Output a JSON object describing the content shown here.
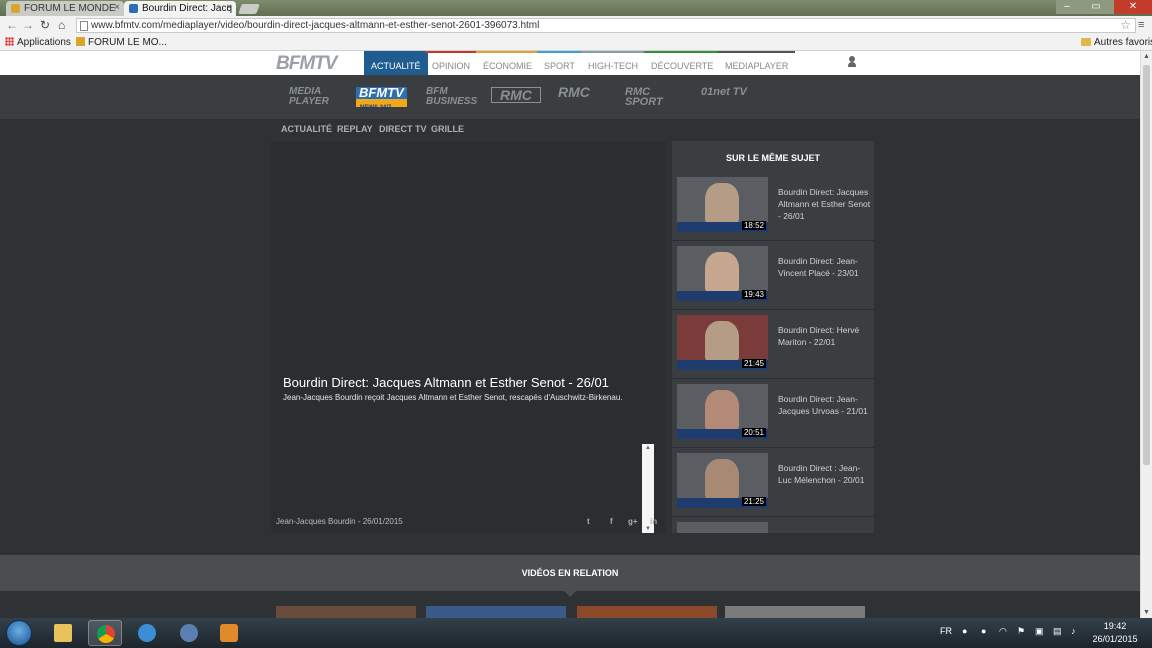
{
  "browser": {
    "tabs": [
      {
        "label": "FORUM LE MONDE",
        "active": false
      },
      {
        "label": "Bourdin Direct: Jacq",
        "active": true
      }
    ],
    "url": "www.bfmtv.com/mediaplayer/video/bourdin-direct-jacques-altmann-et-esther-senot-2601-396073.html",
    "bookmarks": {
      "apps": "Applications",
      "forum": "FORUM LE MO...",
      "other": "Autres favoris"
    }
  },
  "site": {
    "logo": "BFMTV",
    "nav": [
      "ACTUALITÉ",
      "OPINION",
      "ÉCONOMIE",
      "SPORT",
      "HIGH-TECH",
      "DÉCOUVERTE",
      "MEDIAPLAYER"
    ],
    "nav_colors": [
      "#1f5c8f",
      "#c0392b",
      "#e2a32e",
      "#3aa0d8",
      "#8e9aa2",
      "#2f8f3a",
      "#555555"
    ],
    "channels": {
      "media_player": "MEDIA PLAYER",
      "bfmtv": "BFMTV",
      "bfmtv_sub": "NEWS 24/7",
      "bfm_business": "BFM BUSINESS",
      "rmc": "RMC",
      "rmc_decouverte": "RMC",
      "rmc_sport": "RMC SPORT",
      "tv01": "01net TV"
    },
    "subnav": [
      "ACTUALITÉ",
      "REPLAY",
      "DIRECT TV",
      "GRILLE"
    ]
  },
  "video": {
    "title": "Bourdin Direct: Jacques Altmann et Esther Senot - 26/01",
    "description": "Jean-Jacques Bourdin reçoit Jacques Altmann et Esther Senot, rescapés d'Auschwitz-Birkenau.",
    "byline": "Jean-Jacques Bourdin - 26/01/2015",
    "share": [
      "twitter-icon",
      "facebook-icon",
      "googleplus-icon",
      "linkedin-icon"
    ]
  },
  "related": {
    "title": "SUR LE MÊME SUJET",
    "items": [
      {
        "title": "Bourdin Direct: Jacques Altmann et Esther Senot - 26/01",
        "duration": "18:52"
      },
      {
        "title": "Bourdin Direct: Jean-Vincent Placé - 23/01",
        "duration": "19:43"
      },
      {
        "title": "Bourdin Direct: Hervé Mariton - 22/01",
        "duration": "21:45"
      },
      {
        "title": "Bourdin Direct: Jean-Jacques Urvoas - 21/01",
        "duration": "20:51"
      },
      {
        "title": "Bourdin Direct : Jean-Luc Mélenchon - 20/01",
        "duration": "21:25"
      }
    ]
  },
  "videos_relation": {
    "title": "VIDÉOS EN RELATION"
  },
  "taskbar": {
    "lang": "FR",
    "time": "19:42",
    "date": "26/01/2015"
  }
}
